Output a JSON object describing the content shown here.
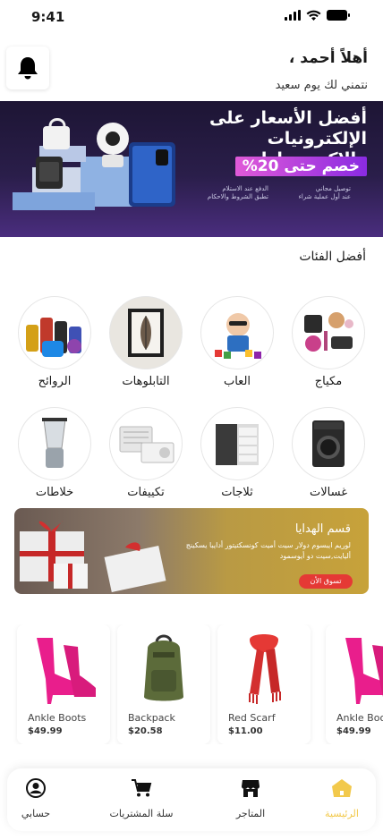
{
  "status_bar": {
    "time": "9:41"
  },
  "header": {
    "greeting": "أهلاً أحمد ،",
    "subgreeting": "نتمني لك يوم سعيد"
  },
  "banner": {
    "title": "أفضل الأسعار على الإلكترونيات والإكسسوارات",
    "discount": "خصم حتى 20%",
    "features": [
      {
        "line1": "توصيل مجاني",
        "line2": "عند أول عملية شراء"
      },
      {
        "line1": "الدفع عند الاستلام",
        "line2": "تطبق الشروط والاحكام"
      }
    ]
  },
  "categories_section": {
    "title": "أفضل الفئات",
    "items": [
      {
        "label": "مكياج",
        "icon": "makeup-icon"
      },
      {
        "label": "العاب",
        "icon": "toys-icon"
      },
      {
        "label": "التابلوهات",
        "icon": "painting-icon"
      },
      {
        "label": "الروائح",
        "icon": "perfume-icon"
      },
      {
        "label": "غسالات",
        "icon": "washer-icon"
      },
      {
        "label": "ثلاجات",
        "icon": "fridge-icon"
      },
      {
        "label": "تكييفات",
        "icon": "ac-icon"
      },
      {
        "label": "خلاطات",
        "icon": "blender-icon"
      }
    ]
  },
  "gift_banner": {
    "title": "قسم الهدايا",
    "description": "لوريم ايبسوم دولار سيت أميت كونسكتيتور أدايبا يسكينج أليايت,سيت دو أيوسمود",
    "button": "تسوق الأن"
  },
  "products": [
    {
      "name": "Ankle Boots",
      "price": "$49.99",
      "icon": "ankle-boot-icon"
    },
    {
      "name": "Backpack",
      "price": "$20.58",
      "icon": "backpack-icon"
    },
    {
      "name": "Red Scarf",
      "price": "$11.00",
      "icon": "scarf-icon"
    },
    {
      "name": "Ankle Boots",
      "price": "$49.99",
      "icon": "ankle-boot-icon"
    }
  ],
  "tabbar": {
    "items": [
      {
        "label": "حسابي",
        "icon": "user-icon"
      },
      {
        "label": "سلة المشتريات",
        "icon": "cart-icon"
      },
      {
        "label": "المتاجر",
        "icon": "store-icon"
      },
      {
        "label": "الرئيسية",
        "icon": "home-icon",
        "active": true
      }
    ]
  },
  "colors": {
    "accent": "#f2c94c",
    "banner_bg": "#2a1e4a",
    "gift_button": "#e53935"
  }
}
